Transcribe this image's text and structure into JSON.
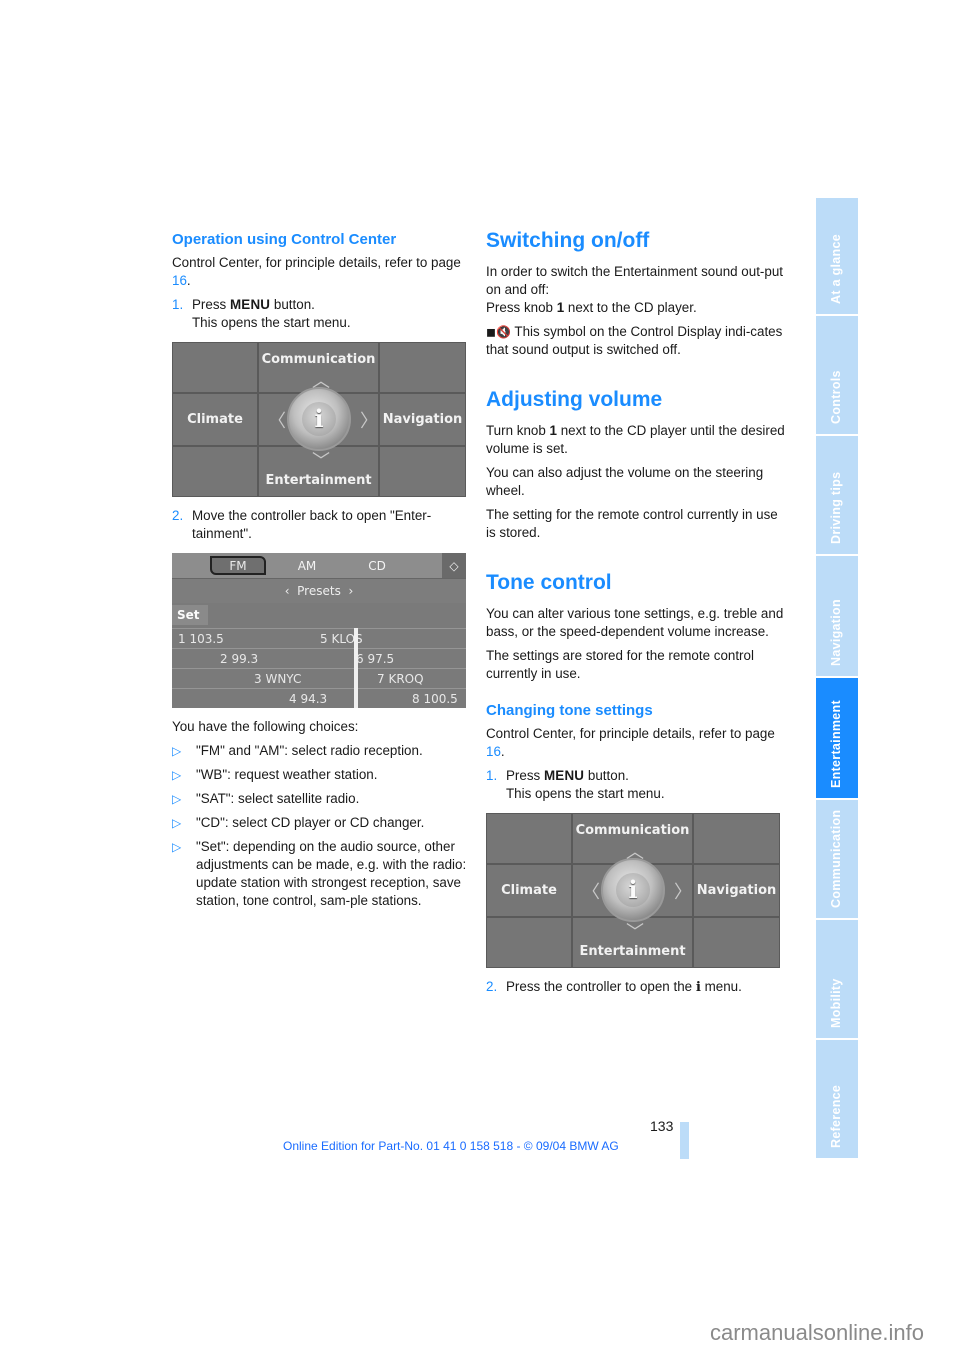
{
  "left": {
    "heading": "Operation using Control Center",
    "intro_text": "Control Center, for principle details, refer to page ",
    "intro_link": "16",
    "intro_end": ".",
    "step1": {
      "num": "1.",
      "pre": "Press ",
      "menu": "MENU",
      "post": " button.",
      "line2": "This opens the start menu."
    },
    "start_menu": {
      "top": "Communication",
      "left": "Climate",
      "right": "Navigation",
      "bottom": "Entertainment",
      "center_icon": "i"
    },
    "step2": {
      "num": "2.",
      "text": "Move the controller back to open \"Enter-tainment\"."
    },
    "radio": {
      "tabs": [
        "FM",
        "AM",
        "CD"
      ],
      "selected_tab": "FM",
      "presets_label": "Presets",
      "set_label": "Set",
      "presets": [
        {
          "left": "1 103.5",
          "right": "5 KLOS"
        },
        {
          "left": "2 99.3",
          "right": "6 97.5"
        },
        {
          "left": "3 WNYC",
          "right": "7 KROQ"
        },
        {
          "left": "4 94.3",
          "right": "8 100.5"
        }
      ]
    },
    "choices_intro": "You have the following choices:",
    "choices": [
      "\"FM\" and \"AM\": select radio reception.",
      "\"WB\": request weather station.",
      "\"SAT\": select satellite radio.",
      "\"CD\": select CD player or CD changer.",
      "\"Set\": depending on the audio source, other adjustments can be made, e.g. with the radio: update station with strongest reception, save station, tone control, sam-ple stations."
    ]
  },
  "right": {
    "switching": {
      "heading": "Switching on/off",
      "p1": "In order to switch the Entertainment sound out-put on and off:",
      "p2_pre": "Press knob ",
      "p2_bold": "1",
      "p2_post": " next to the CD player.",
      "p3": " This symbol on the Control Display indi-cates that sound output is switched off."
    },
    "volume": {
      "heading": "Adjusting volume",
      "p1_pre": "Turn knob ",
      "p1_bold": "1",
      "p1_post": " next to the CD player until the desired volume is set.",
      "p2": "You can also adjust the volume on the steering wheel.",
      "p3": "The setting for the remote control currently in use is stored."
    },
    "tone": {
      "heading": "Tone control",
      "p1": "You can alter various tone settings, e.g. treble and bass, or the speed-dependent volume increase.",
      "p2": "The settings are stored for the remote control currently in use."
    },
    "changing": {
      "heading": "Changing tone settings",
      "intro_text": "Control Center, for principle details, refer to page ",
      "intro_link": "16",
      "intro_end": ".",
      "step1": {
        "num": "1.",
        "pre": "Press ",
        "menu": "MENU",
        "post": " button.",
        "line2": "This opens the start menu."
      },
      "start_menu": {
        "top": "Communication",
        "left": "Climate",
        "right": "Navigation",
        "bottom": "Entertainment",
        "center_icon": "i"
      },
      "step2": {
        "num": "2.",
        "pre": "Press the controller to open the ",
        "icon": "i",
        "post": " menu."
      }
    }
  },
  "sidebar": {
    "tabs": [
      "At a glance",
      "Controls",
      "Driving tips",
      "Navigation",
      "Entertainment",
      "Communication",
      "Mobility",
      "Reference"
    ],
    "active": "Entertainment",
    "colors": {
      "inactive": "#bcdcf8",
      "active": "#1a8cff"
    }
  },
  "footer": {
    "page_number": "133",
    "edition": "Online Edition for Part-No. 01 41 0 158 518 - © 09/04 BMW AG",
    "site": "carmanualsonline.info"
  }
}
